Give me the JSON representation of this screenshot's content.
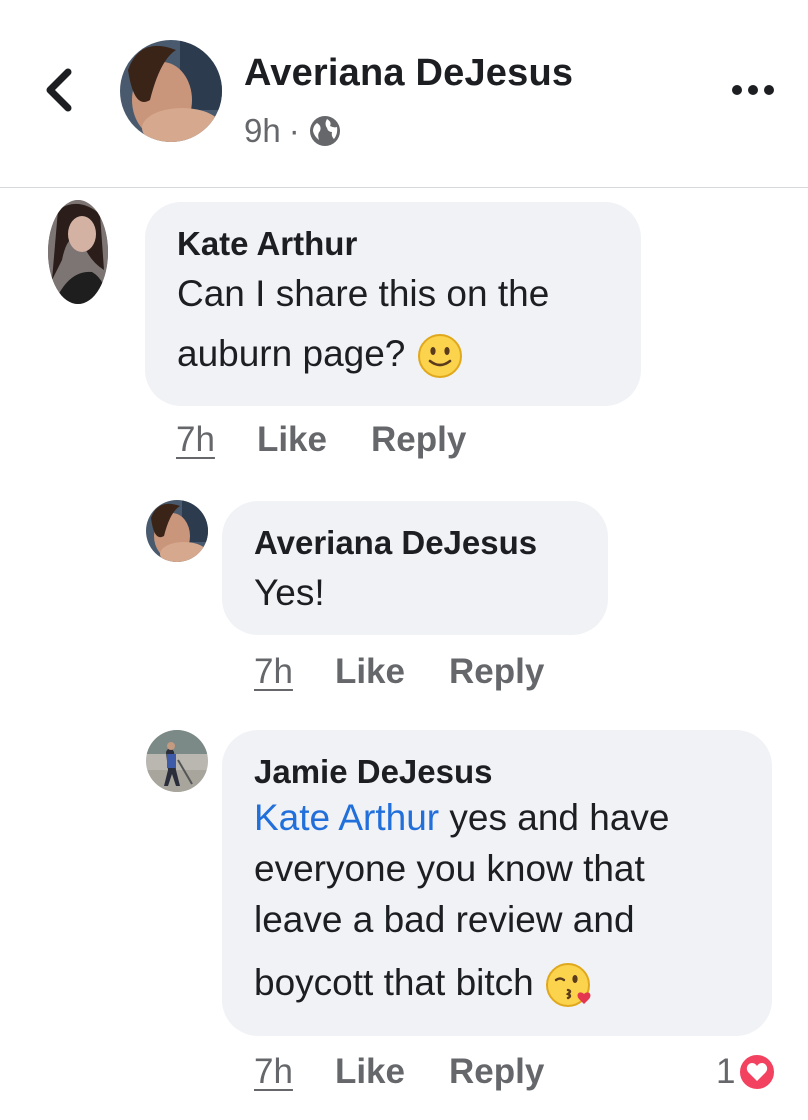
{
  "header": {
    "author_name": "Averiana DeJesus",
    "time": "9h",
    "separator": "·",
    "back_icon": "chevron-left-icon",
    "globe_icon": "globe-icon",
    "more_icon": "more-icon"
  },
  "comments": [
    {
      "author": "Kate Arthur",
      "text": "Can I share this on the auburn page?",
      "emoji": "slightly-smiling-face",
      "time": "7h",
      "like_label": "Like",
      "reply_label": "Reply"
    },
    {
      "author": "Averiana DeJesus",
      "text": "Yes!",
      "time": "7h",
      "like_label": "Like",
      "reply_label": "Reply"
    },
    {
      "author": "Jamie DeJesus",
      "mention": "Kate Arthur",
      "text_line1": " yes and have",
      "text_line2": "everyone you know that",
      "text_line3": "leave a bad review and",
      "text_line4": "boycott that bitch",
      "emoji": "face-blowing-kiss",
      "time": "7h",
      "like_label": "Like",
      "reply_label": "Reply",
      "reaction_count": "1",
      "reaction_icon": "heart-icon"
    }
  ],
  "colors": {
    "bubble": "#f0f2f5",
    "meta_text": "#65676b",
    "mention": "#216fdb",
    "heart": "#f3425f"
  }
}
